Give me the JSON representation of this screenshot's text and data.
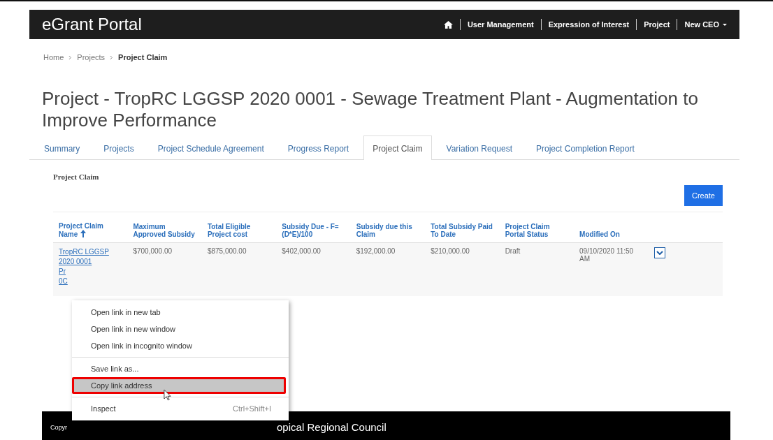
{
  "header": {
    "brand": "eGrant Portal",
    "nav": [
      "User Management",
      "Expression of Interest",
      "Project",
      "New CEO"
    ]
  },
  "breadcrumb": [
    {
      "label": "Home",
      "current": false
    },
    {
      "label": "Projects",
      "current": false
    },
    {
      "label": "Project Claim",
      "current": true
    }
  ],
  "title": "Project - TropRC LGGSP 2020 0001 - Sewage Treatment Plant - Augmentation to Improve Performance",
  "tabs": [
    {
      "label": "Summary",
      "selected": false
    },
    {
      "label": "Projects",
      "selected": false
    },
    {
      "label": "Project Schedule Agreement",
      "selected": false
    },
    {
      "label": "Progress Report",
      "selected": false
    },
    {
      "label": "Project Claim",
      "selected": true
    },
    {
      "label": "Variation Request",
      "selected": false
    },
    {
      "label": "Project Completion Report",
      "selected": false
    }
  ],
  "section_title": "Project Claim",
  "create_button": "Create",
  "table": {
    "columns": [
      {
        "label": "Project Claim Name",
        "sorted": true
      },
      {
        "label": "Maximum Approved Subsidy",
        "sorted": false
      },
      {
        "label": "Total Eligible Project cost",
        "sorted": false
      },
      {
        "label": "Subsidy Due - F=(D*E)/100",
        "sorted": false
      },
      {
        "label": "Subsidy due this Claim",
        "sorted": false
      },
      {
        "label": "Total Subsidy Paid To Date",
        "sorted": false
      },
      {
        "label": "Project Claim Portal Status",
        "sorted": false
      },
      {
        "label": "Modified On",
        "sorted": false
      }
    ],
    "rows": [
      {
        "cells": [
          "TropRC LGGSP\n2020 0001\nPr\n0C",
          "$700,000.00",
          "$875,000.00",
          "$402,000.00",
          "$192,000.00",
          "$210,000.00",
          "Draft",
          "09/10/2020 11:50 AM"
        ]
      }
    ]
  },
  "footer": [
    "Copyr",
    "opical Regional Council"
  ],
  "context_menu": [
    [
      {
        "label": "Open link in new tab",
        "highlighted": false
      },
      {
        "label": "Open link in new window",
        "highlighted": false
      },
      {
        "label": "Open link in incognito window",
        "highlighted": false
      }
    ],
    [
      {
        "label": "Save link as...",
        "highlighted": false
      },
      {
        "label": "Copy link address",
        "highlighted": true
      }
    ],
    [
      {
        "label": "Inspect",
        "shortcut": "Ctrl+Shift+I",
        "highlighted": false
      }
    ]
  ]
}
